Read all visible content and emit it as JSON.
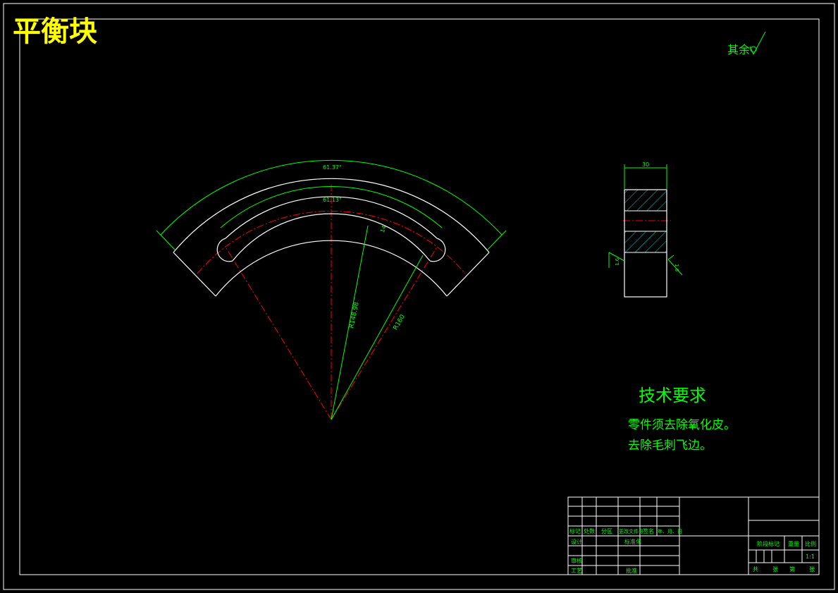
{
  "title": "平衡块",
  "surface_note": "其余",
  "dimensions": {
    "outer_angle": "61.37°",
    "inner_angle": "61.13°",
    "slot_width": "14",
    "radius_1": "R148.98",
    "radius_2": "R160",
    "thickness": "30",
    "roughness_left": "1.6",
    "roughness_right": "1.6"
  },
  "tech_req": {
    "heading": "技术要求",
    "items": [
      "零件须去除氧化皮。",
      "去除毛刺飞边。"
    ]
  },
  "title_block": {
    "headers": [
      "标记",
      "处数",
      "分区",
      "更改文件号",
      "签名",
      "年、月、日"
    ],
    "design": "设计",
    "standardize": "标准化",
    "review": "审核",
    "process": "工艺",
    "approve": "批准",
    "stage_mark": "阶段标记",
    "weight": "重量",
    "scale": "比例",
    "scale_value": "1:1",
    "sheets_total": "共",
    "sheet_unit": "张",
    "sheet_no": "第",
    "sheet_unit2": "张"
  },
  "colors": {
    "background": "#000000",
    "outline": "#ffffff",
    "dimension": "#00ff00",
    "center_line": "#ff0000",
    "title": "#ffff00",
    "hatch": "#00ffff"
  }
}
